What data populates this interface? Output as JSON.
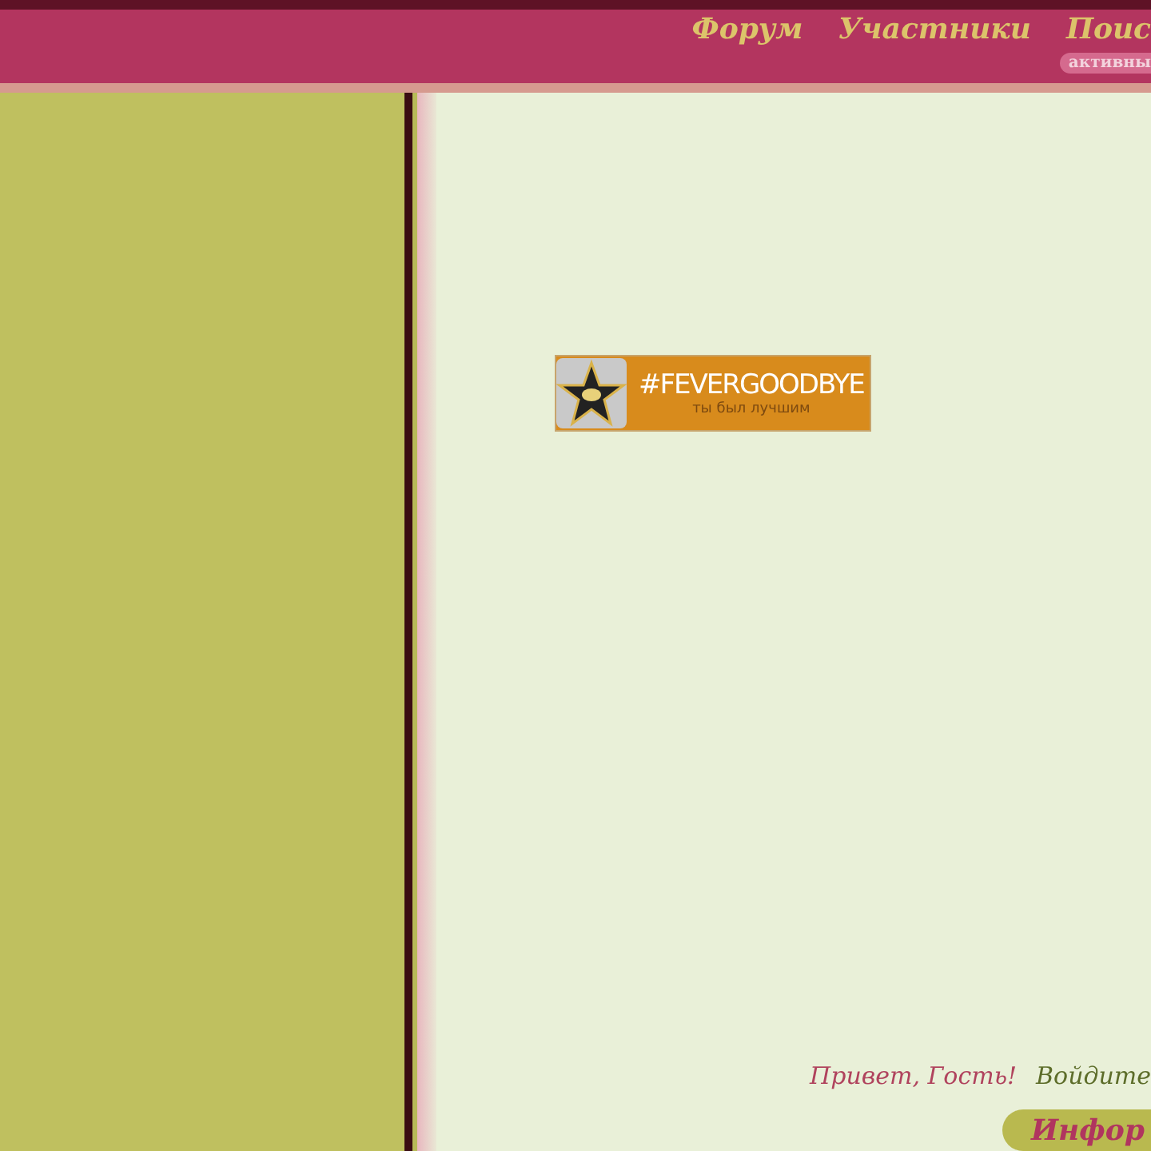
{
  "nav": {
    "items": [
      "Форум",
      "Участники",
      "Поис"
    ],
    "badge": "активны"
  },
  "banner": {
    "title": "#FEVERGOODBYE",
    "subtitle": "ты был лучшим"
  },
  "greeting": {
    "hello": "Привет, Гость!",
    "login": "Войдите"
  },
  "info_button": "Инфор"
}
